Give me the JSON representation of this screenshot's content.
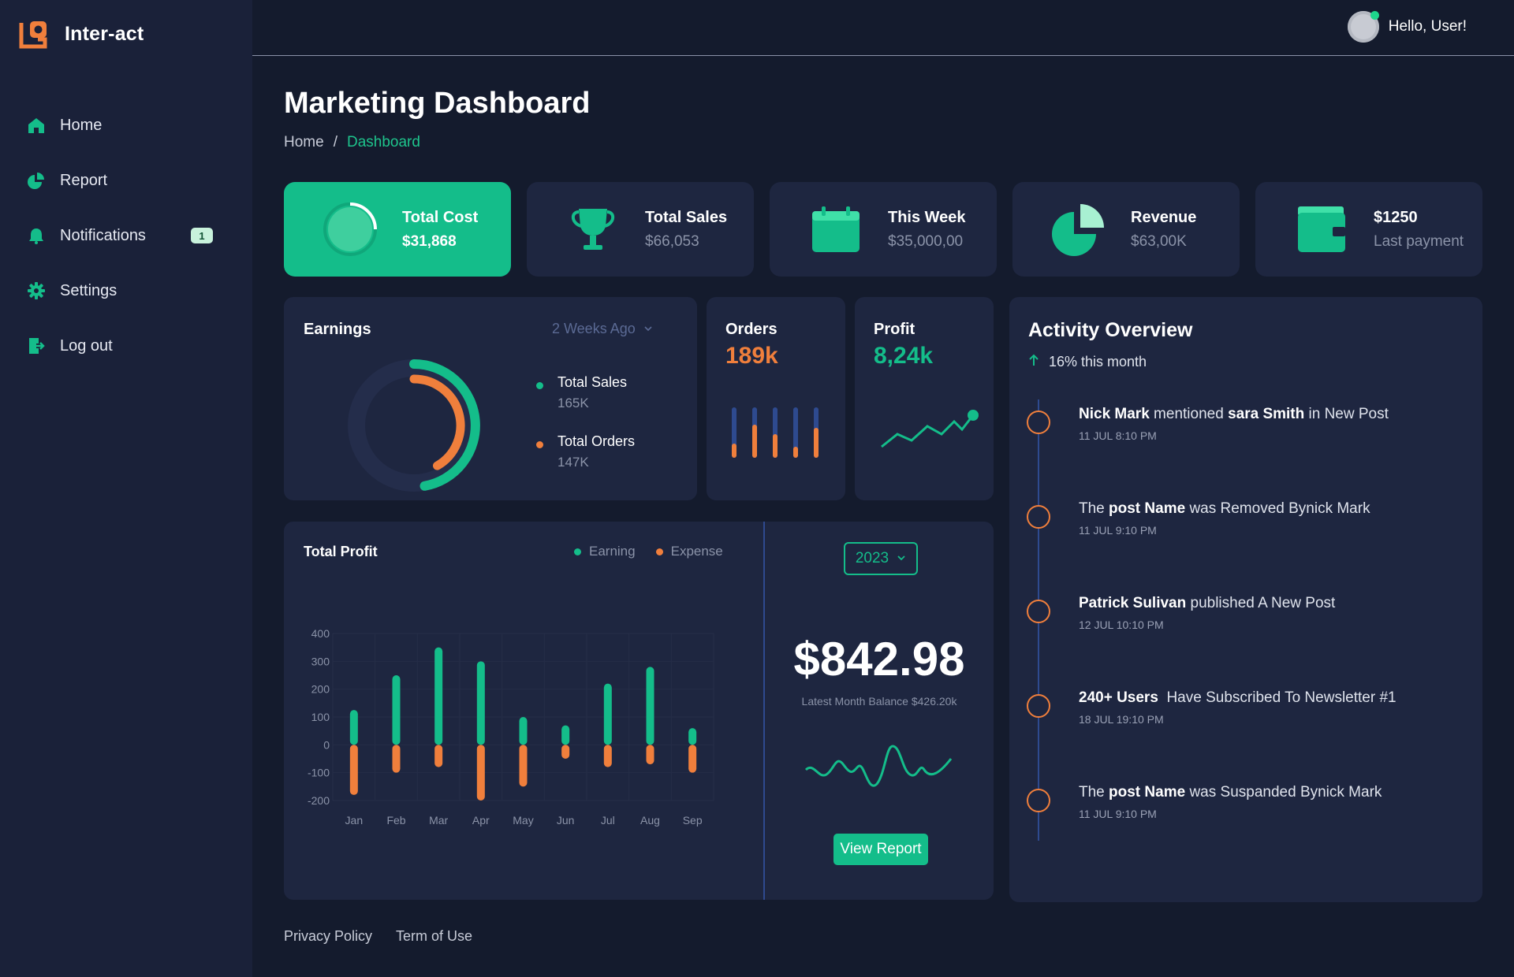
{
  "app": {
    "name": "Inter-act"
  },
  "sidebar": {
    "items": [
      {
        "label": "Home",
        "icon": "home-icon"
      },
      {
        "label": "Report",
        "icon": "pie-chart-icon"
      },
      {
        "label": "Notifications",
        "icon": "bell-icon",
        "badge": "1"
      },
      {
        "label": "Settings",
        "icon": "gear-icon"
      },
      {
        "label": "Log out",
        "icon": "logout-icon"
      }
    ]
  },
  "topbar": {
    "greeting": "Hello, User!"
  },
  "header": {
    "title": "Marketing Dashboard",
    "breadcrumb": {
      "home": "Home",
      "separator": "/",
      "current": "Dashboard"
    }
  },
  "stats": [
    {
      "title": "Total Cost",
      "value": "$31,868",
      "icon": "progress-ring-icon"
    },
    {
      "title": "Total Sales",
      "value": "$66,053",
      "icon": "trophy-icon"
    },
    {
      "title": "This Week",
      "value": "$35,000,00",
      "icon": "calendar-icon"
    },
    {
      "title": "Revenue",
      "value": "$63,00K",
      "icon": "pie-chart-icon"
    },
    {
      "title": "$1250",
      "value": "Last payment",
      "icon": "wallet-icon"
    }
  ],
  "earnings": {
    "title": "Earnings",
    "period": "2 Weeks Ago",
    "legend": [
      {
        "label": "Total Sales",
        "value": "165K",
        "color": "#14bd8a"
      },
      {
        "label": "Total Orders",
        "value": "147K",
        "color": "#f07f3c"
      }
    ]
  },
  "orders": {
    "title": "Orders",
    "value": "189k"
  },
  "profit": {
    "title": "Profit",
    "value": "8,24k"
  },
  "total_profit": {
    "title": "Total Profit",
    "legend": [
      {
        "label": "Earning",
        "color": "#14bd8a"
      },
      {
        "label": "Expense",
        "color": "#f07f3c"
      }
    ],
    "year": "2023",
    "balance": "$842.98",
    "balance_note": "Latest Month Balance $426.20k",
    "button": "View Report"
  },
  "chart_data": {
    "type": "bar",
    "title": "Total Profit",
    "categories": [
      "Jan",
      "Feb",
      "Mar",
      "Apr",
      "May",
      "Jun",
      "Jul",
      "Aug",
      "Sep"
    ],
    "series": [
      {
        "name": "Earning",
        "color": "#14bd8a",
        "values": [
          125,
          250,
          350,
          300,
          100,
          70,
          220,
          280,
          60
        ]
      },
      {
        "name": "Expense",
        "color": "#f07f3c",
        "values": [
          -180,
          -100,
          -80,
          -200,
          -150,
          -50,
          -80,
          -70,
          -100
        ]
      }
    ],
    "yticks": [
      400,
      300,
      200,
      100,
      0,
      -100,
      -200
    ],
    "ylim": [
      -200,
      400
    ],
    "grid": true
  },
  "activity": {
    "title": "Activity Overview",
    "subtitle": "16% this month",
    "items": [
      {
        "parts": [
          [
            "Nick Mark",
            true
          ],
          [
            " mentioned ",
            false
          ],
          [
            "sara Smith",
            true
          ],
          [
            " in New Post",
            false
          ]
        ],
        "time": "11 JUL 8:10 PM"
      },
      {
        "parts": [
          [
            "The ",
            false
          ],
          [
            "post Name",
            true
          ],
          [
            " was Removed Bynick Mark",
            false
          ]
        ],
        "time": "11 JUL 9:10 PM"
      },
      {
        "parts": [
          [
            "Patrick Sulivan",
            true
          ],
          [
            " published A New Post",
            false
          ]
        ],
        "time": "12 JUL 10:10 PM"
      },
      {
        "parts": [
          [
            "240+ Users",
            true
          ],
          [
            "  Have Subscribed To Newsletter #1",
            false
          ]
        ],
        "time": "18 JUL 19:10 PM"
      },
      {
        "parts": [
          [
            "The ",
            false
          ],
          [
            "post Name",
            true
          ],
          [
            " was Suspanded Bynick Mark",
            false
          ]
        ],
        "time": "11 JUL 9:10 PM"
      }
    ]
  },
  "footer": {
    "links": [
      "Privacy Policy",
      "Term of Use"
    ]
  },
  "colors": {
    "accent": "#14bd8a",
    "orange": "#f07f3c",
    "panel": "#1e2640",
    "bg": "#141b2d",
    "sidebar": "#1a2139"
  }
}
